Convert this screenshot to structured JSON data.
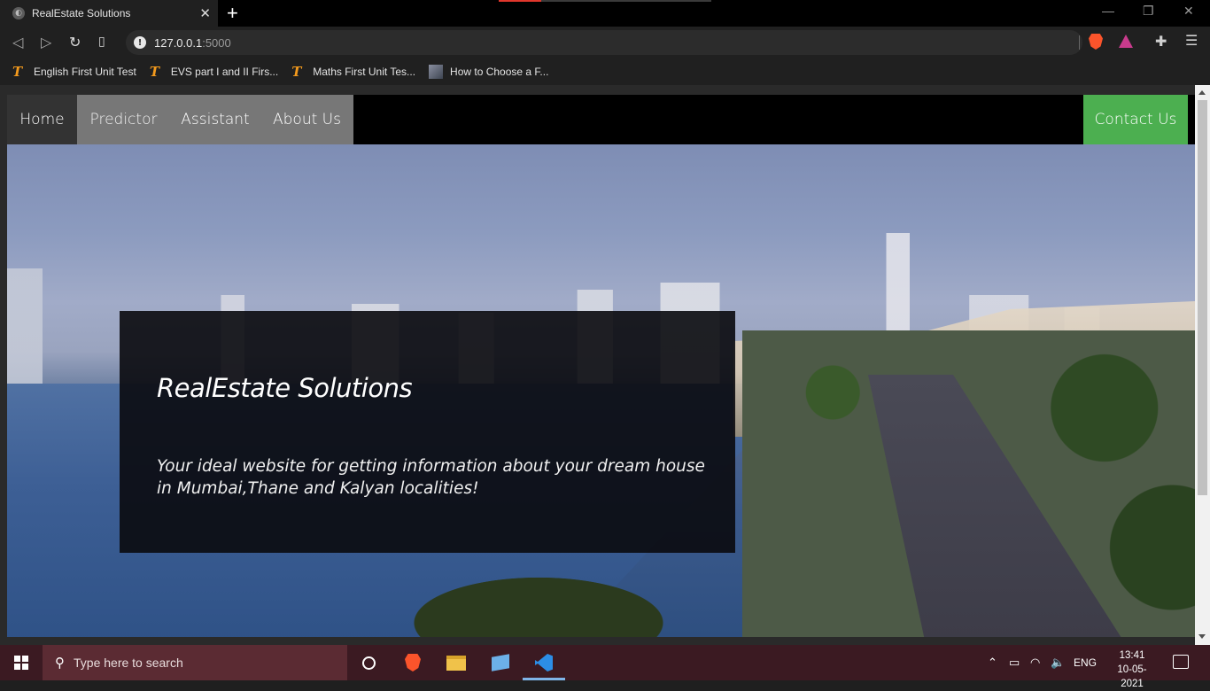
{
  "browser": {
    "tab_title": "RealEstate Solutions",
    "tab_close": "✕",
    "new_tab": "+",
    "url_host": "127.0.0.1",
    "url_port": ":5000",
    "bookmarks": [
      {
        "label": "English First Unit Test",
        "icon": "T"
      },
      {
        "label": "EVS part I and II Firs...",
        "icon": "T"
      },
      {
        "label": "Maths First Unit Tes...",
        "icon": "T"
      },
      {
        "label": "How to Choose a F...",
        "icon": "image"
      }
    ],
    "accent_color": "#e0362c"
  },
  "site": {
    "nav": {
      "home": "Home",
      "predictor": "Predictor",
      "assistant": "Assistant",
      "about": "About Us",
      "contact": "Contact Us"
    },
    "hero": {
      "title": "RealEstate Solutions",
      "tagline": "Your ideal website for getting information about your dream house in Mumbai,Thane and Kalyan localities!"
    },
    "colors": {
      "contact_button": "#4caf50",
      "nav_active": "#333333",
      "nav_predictor": "#777777"
    }
  },
  "taskbar": {
    "search_placeholder": "Type here to search",
    "language": "ENG",
    "time": "13:41",
    "date": "10-05-2021"
  }
}
